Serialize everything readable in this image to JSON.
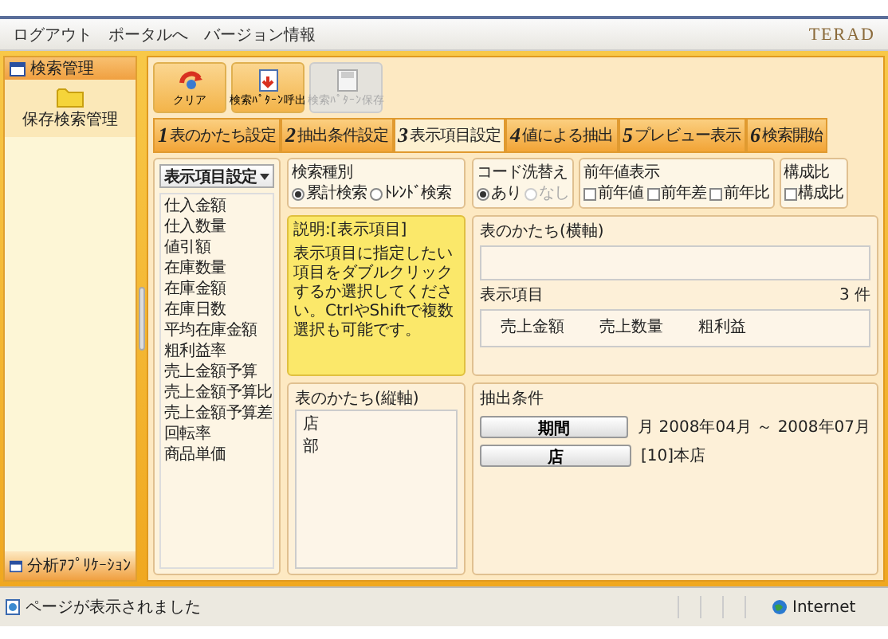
{
  "menu_links": [
    "ログアウト",
    "ポータルへ",
    "バージョン情報"
  ],
  "logo": "TERAD",
  "sidebar": {
    "title": "検索管理",
    "items": [
      "保存検索管理"
    ],
    "footer": "分析ｱﾌﾟﾘｹｰｼｮﾝ"
  },
  "toolbar": [
    {
      "label": "クリア",
      "kind": "clear",
      "disabled": false
    },
    {
      "label": "検索ﾊﾟﾀｰﾝ呼出",
      "kind": "load",
      "disabled": false
    },
    {
      "label": "検索ﾊﾟﾀｰﾝ保存",
      "kind": "save",
      "disabled": true
    }
  ],
  "steps": [
    {
      "number": "1",
      "label": "表のかたち設定",
      "selected": false
    },
    {
      "number": "2",
      "label": "抽出条件設定",
      "selected": false
    },
    {
      "number": "3",
      "label": "表示項目設定",
      "selected": true
    },
    {
      "number": "4",
      "label": "値による抽出",
      "selected": false
    },
    {
      "number": "5",
      "label": "プレビュー表示",
      "selected": false
    },
    {
      "number": "6",
      "label": "検索開始",
      "selected": false
    }
  ],
  "item_list": {
    "dropdown": "表示項目設定",
    "items": [
      "仕入金額",
      "仕入数量",
      "値引額",
      "在庫数量",
      "在庫金額",
      "在庫日数",
      "平均在庫金額",
      "粗利益率",
      "売上金額予算",
      "売上金額予算比",
      "売上金額予算差",
      "回転率",
      "商品単価"
    ]
  },
  "search_type": {
    "title": "検索種別",
    "options": [
      {
        "label": "累計検索",
        "selected": true,
        "disabled": false
      },
      {
        "label": "ﾄﾚﾝﾄﾞ検索",
        "selected": false,
        "disabled": false
      }
    ]
  },
  "code_replace": {
    "title": "コード洗替え",
    "options": [
      {
        "label": "あり",
        "selected": true,
        "disabled": false
      },
      {
        "label": "なし",
        "selected": false,
        "disabled": true
      }
    ]
  },
  "prev_year": {
    "title": "前年値表示",
    "options": [
      {
        "label": "前年値",
        "checked": false
      },
      {
        "label": "前年差",
        "checked": false
      },
      {
        "label": "前年比",
        "checked": false
      }
    ]
  },
  "composition": {
    "title": "構成比",
    "options": [
      {
        "label": "構成比",
        "checked": false
      }
    ]
  },
  "note": {
    "title": "説明:[表示項目]",
    "text": "表示項目に指定したい項目をダブルクリックするか選択してください。CtrlやShiftで複数選択も可能です。"
  },
  "horizontal_axis": {
    "title": "表のかたち(横軸)"
  },
  "display_items": {
    "title": "表示項目",
    "count": "3",
    "unit": "件",
    "items": [
      "売上金額",
      "売上数量",
      "粗利益"
    ]
  },
  "vertical_axis": {
    "title": "表のかたち(縦軸)",
    "items": [
      "店",
      "部"
    ]
  },
  "conditions": {
    "title": "抽出条件",
    "rows": [
      {
        "button": "期間",
        "value": "月 2008年04月 ～ 2008年07月"
      },
      {
        "button": "店",
        "value": "[10]本店"
      }
    ]
  },
  "status_bar": {
    "message": "ページが表示されました",
    "zone": "Internet"
  }
}
